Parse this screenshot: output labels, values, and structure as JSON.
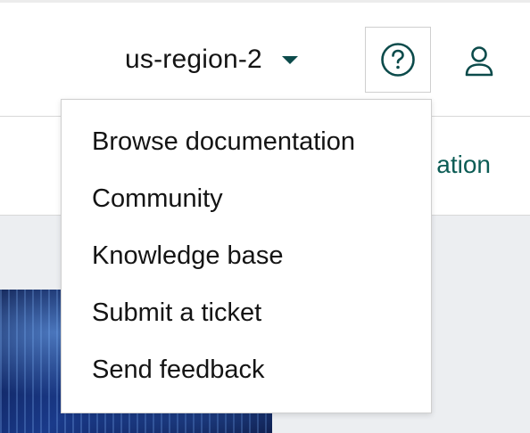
{
  "header": {
    "region": {
      "label": "us-region-2",
      "icon": "caret-down-icon"
    },
    "help_button": {
      "icon": "help-circle-icon"
    },
    "user_button": {
      "icon": "user-icon"
    }
  },
  "tabs": {
    "partial_label": "ation"
  },
  "help_menu": {
    "items": [
      {
        "label": "Browse documentation"
      },
      {
        "label": "Community"
      },
      {
        "label": "Knowledge base"
      },
      {
        "label": "Submit a ticket"
      },
      {
        "label": "Send feedback"
      }
    ]
  },
  "colors": {
    "accent": "#0c4b4b",
    "tab_text": "#0c5c55",
    "text": "#141414",
    "content_bg": "#eceef1"
  }
}
